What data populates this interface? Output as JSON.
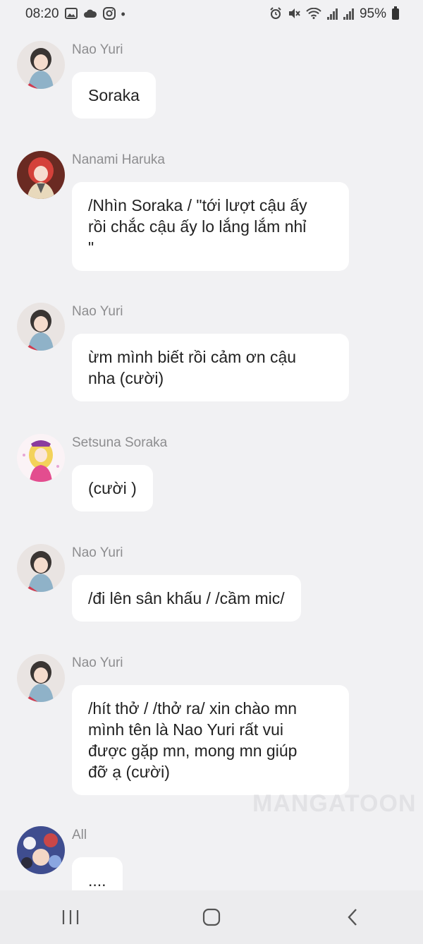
{
  "status_bar": {
    "time": "08:20",
    "battery": "95%",
    "icons_left": [
      "image-icon",
      "cloud-icon",
      "instagram-icon",
      "dot-icon"
    ],
    "icons_right": [
      "alarm-icon",
      "mute-icon",
      "wifi-icon",
      "signal-icon",
      "signal-icon",
      "battery-icon"
    ]
  },
  "messages": [
    {
      "sender": "Nao Yuri",
      "text": "Soraka"
    },
    {
      "sender": "Nanami Haruka",
      "text": "/Nhìn Soraka / \"tới lượt cậu ấy\nrồi chắc cậu ấy lo lắng lắm nhỉ\n\""
    },
    {
      "sender": "Nao Yuri",
      "text": "ừm mình biết rồi cảm ơn cậu\nnha (cười)"
    },
    {
      "sender": "Setsuna Soraka",
      "text": "(cười )"
    },
    {
      "sender": "Nao Yuri",
      "text": "/đi lên sân khấu / /cầm mic/"
    },
    {
      "sender": "Nao Yuri",
      "text": "/hít thở / /thở ra/ xin chào mn\nmình tên là Nao Yuri rất vui\nđược gặp mn, mong mn giúp\nđỡ ạ (cười)"
    },
    {
      "sender": "All",
      "text": "...."
    }
  ],
  "watermark": "MANGATOON",
  "colors": {
    "background": "#f1f1f3",
    "bubble": "#ffffff",
    "sender_name": "#8d8d8f"
  }
}
